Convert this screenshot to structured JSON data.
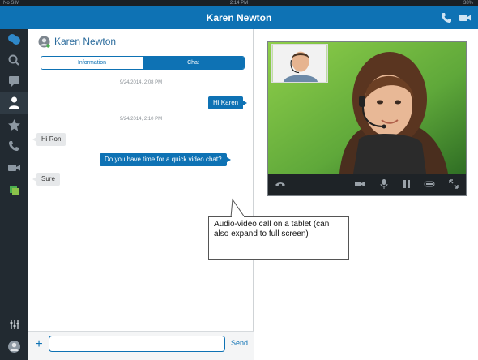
{
  "status_bar": {
    "carrier": "No SIM",
    "time": "2:14 PM",
    "battery": "38%"
  },
  "title_bar": {
    "title": "Karen Newton"
  },
  "chat": {
    "contact_name": "Karen Newton",
    "tabs": [
      {
        "label": "Information"
      },
      {
        "label": "Chat"
      }
    ],
    "messages": [
      {
        "timestamp": "9/24/2014, 2:08 PM"
      },
      {
        "text": "Hi Karen",
        "direction": "out"
      },
      {
        "timestamp": "9/24/2014, 2:10 PM"
      },
      {
        "text": "Hi Ron",
        "direction": "in"
      },
      {
        "text": "Do you have time for a quick video chat?",
        "direction": "out"
      },
      {
        "text": "Sure",
        "direction": "in"
      }
    ],
    "compose": {
      "placeholder": "",
      "send_label": "Send"
    }
  },
  "callout": {
    "text": "Audio-video call on a tablet (can also expand to full screen)"
  },
  "icons": {
    "rail": [
      "chat-bubbles-icon",
      "search-icon",
      "message-icon",
      "contact-icon",
      "star-icon",
      "phone-icon",
      "video-icon",
      "presence-icon",
      "settings-sliders-icon",
      "user-avatar-icon"
    ],
    "title": [
      "phone-icon",
      "video-icon"
    ],
    "video_controls": [
      "hang-up-icon",
      "video-toggle-icon",
      "microphone-icon",
      "pause-icon",
      "speaker-icon",
      "expand-icon"
    ]
  },
  "colors": {
    "accent": "#0e72b4",
    "rail": "#222a31",
    "incoming_bubble": "#e6e8ea"
  }
}
